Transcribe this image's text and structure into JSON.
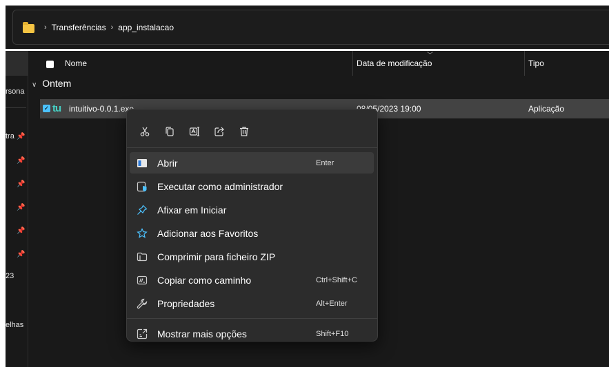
{
  "breadcrumb": {
    "part1": "Transferências",
    "part2": "app_instalacao",
    "separator": "›"
  },
  "sidebar": {
    "items": [
      {
        "label": "rsona",
        "pinned": false
      },
      {
        "label": "tra",
        "pinned": true
      },
      {
        "label": "",
        "pinned": true
      },
      {
        "label": "",
        "pinned": true
      },
      {
        "label": "",
        "pinned": true
      },
      {
        "label": "",
        "pinned": true
      },
      {
        "label": "",
        "pinned": true
      },
      {
        "label": "23",
        "pinned": false
      },
      {
        "label": "elhas",
        "pinned": false
      }
    ],
    "pin_glyph": "📌"
  },
  "columns": {
    "name": "Nome",
    "date": "Data de modificação",
    "type": "Tipo"
  },
  "group": {
    "label": "Ontem"
  },
  "file": {
    "icon_text": "tu",
    "name": "intuitivo-0.0.1.exe",
    "date": "08/05/2023 19:00",
    "type": "Aplicação"
  },
  "context_menu": {
    "toolbar": [
      {
        "name": "cut-icon"
      },
      {
        "name": "copy-icon"
      },
      {
        "name": "rename-icon"
      },
      {
        "name": "share-icon"
      },
      {
        "name": "delete-icon"
      }
    ],
    "items": [
      {
        "label": "Abrir",
        "shortcut": "Enter",
        "icon": "open-app-icon"
      },
      {
        "label": "Executar como administrador",
        "shortcut": "",
        "icon": "admin-shield-icon"
      },
      {
        "label": "Afixar em Iniciar",
        "shortcut": "",
        "icon": "pin-icon"
      },
      {
        "label": "Adicionar aos Favoritos",
        "shortcut": "",
        "icon": "star-icon"
      },
      {
        "label": "Comprimir para ficheiro ZIP",
        "shortcut": "",
        "icon": "zip-folder-icon"
      },
      {
        "label": "Copiar como caminho",
        "shortcut": "Ctrl+Shift+C",
        "icon": "copy-path-icon"
      },
      {
        "label": "Propriedades",
        "shortcut": "Alt+Enter",
        "icon": "wrench-icon"
      },
      {
        "label": "Mostrar mais opções",
        "shortcut": "Shift+F10",
        "icon": "more-options-icon"
      }
    ]
  },
  "colors": {
    "accent": "#4cc2ff",
    "selection": "#434343",
    "menu_bg": "#2c2c2c",
    "folder": "#f5c443"
  }
}
